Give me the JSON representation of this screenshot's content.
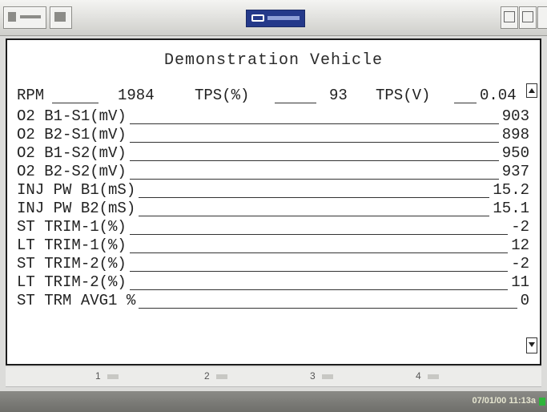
{
  "app": {
    "title": "Demonstration Vehicle"
  },
  "header": {
    "rpm_label": "RPM",
    "rpm_value": "1984",
    "tps_pct_label": "TPS(%)",
    "tps_pct_value": "93",
    "tps_v_label": "TPS(V)",
    "tps_v_value": "0.04"
  },
  "rows": [
    {
      "label": "O2 B1-S1(mV)",
      "value": "903"
    },
    {
      "label": "O2 B2-S1(mV)",
      "value": "898"
    },
    {
      "label": "O2 B1-S2(mV)",
      "value": "950"
    },
    {
      "label": "O2 B2-S2(mV)",
      "value": "937"
    },
    {
      "label": "INJ PW B1(mS)",
      "value": "15.2"
    },
    {
      "label": "INJ PW B2(mS)",
      "value": "15.1"
    },
    {
      "label": "ST TRIM-1(%)",
      "value": "-2"
    },
    {
      "label": "LT TRIM-1(%)",
      "value": "12"
    },
    {
      "label": "ST TRIM-2(%)",
      "value": "-2"
    },
    {
      "label": "LT TRIM-2(%)",
      "value": "11"
    },
    {
      "label": "ST TRM AVG1 %",
      "value": "0"
    }
  ],
  "tabs": [
    "1",
    "2",
    "3",
    "4"
  ],
  "status": {
    "datetime": "07/01/00   11:13a"
  },
  "icons": [
    "toolbar-menu-icon",
    "toolbar-grid-icon",
    "scanner-logo",
    "window-icon",
    "print-icon",
    "page-icon",
    "scroll-up-icon",
    "scroll-down-icon"
  ]
}
